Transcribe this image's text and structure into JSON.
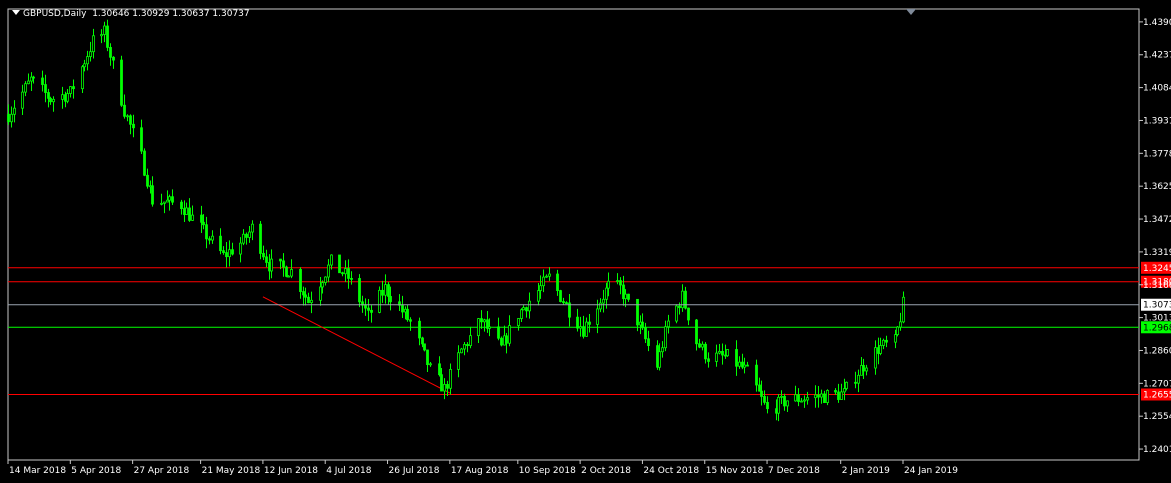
{
  "header": {
    "symbol_timeframe": "GBPUSD,Daily",
    "ohlc": "1.30646 1.30929 1.30637 1.30737"
  },
  "colors": {
    "background": "#000000",
    "frame": "#c8c8c8",
    "candle": "#00ff00",
    "red_line": "#ff0000",
    "green_line": "#00ff00",
    "price_line": "#9aa4b0",
    "trend_line": "#ff0000"
  },
  "chart_data": {
    "type": "candlestick",
    "timeframe": "Daily",
    "y_axis": {
      "position": "right",
      "ticks": [
        "1.4390",
        "1.4237",
        "1.4084",
        "1.3931",
        "1.3778",
        "1.3625",
        "1.3472",
        "1.3319",
        "1.3166",
        "1.3013",
        "1.2860",
        "1.2707",
        "1.2554",
        "1.2401"
      ],
      "range": [
        1.235,
        1.445
      ]
    },
    "x_axis": {
      "ticks": [
        "14 Mar 2018",
        "5 Apr 2018",
        "27 Apr 2018",
        "21 May 2018",
        "12 Jun 2018",
        "4 Jul 2018",
        "26 Jul 2018",
        "17 Aug 2018",
        "10 Sep 2018",
        "2 Oct 2018",
        "24 Oct 2018",
        "15 Nov 2018",
        "7 Dec 2018",
        "2 Jan 2019",
        "24 Jan 2019"
      ]
    },
    "current_price": "1.3073",
    "horizontal_lines": [
      {
        "price": 1.3245,
        "color": "#ff0000",
        "label": "1.3245"
      },
      {
        "price": 1.318,
        "color": "#ff0000",
        "label": "1.3180"
      },
      {
        "price": 1.2968,
        "color": "#00ff00",
        "label": "1.2968"
      },
      {
        "price": 1.2655,
        "color": "#ff0000",
        "label": "1.2655"
      }
    ],
    "trend_line": {
      "from": {
        "date": "12 Jun 2018",
        "price": 1.311
      },
      "to": {
        "date": "17 Aug 2018",
        "price": 1.2662
      }
    },
    "anchors": [
      {
        "t": "14 Mar 2018",
        "p": 1.396
      },
      {
        "t": "22 Mar 2018",
        "p": 1.412
      },
      {
        "t": "29 Mar 2018",
        "p": 1.403
      },
      {
        "t": "5 Apr 2018",
        "p": 1.406
      },
      {
        "t": "13 Apr 2018",
        "p": 1.43
      },
      {
        "t": "17 Apr 2018",
        "p": 1.434
      },
      {
        "t": "24 Apr 2018",
        "p": 1.398
      },
      {
        "t": "30 Apr 2018",
        "p": 1.376
      },
      {
        "t": "4 May 2018",
        "p": 1.356
      },
      {
        "t": "14 May 2018",
        "p": 1.354
      },
      {
        "t": "21 May 2018",
        "p": 1.343
      },
      {
        "t": "29 May 2018",
        "p": 1.33
      },
      {
        "t": "5 Jun 2018",
        "p": 1.337
      },
      {
        "t": "8 Jun 2018",
        "p": 1.343
      },
      {
        "t": "14 Jun 2018",
        "p": 1.326
      },
      {
        "t": "22 Jun 2018",
        "p": 1.323
      },
      {
        "t": "28 Jun 2018",
        "p": 1.309
      },
      {
        "t": "6 Jul 2018",
        "p": 1.327
      },
      {
        "t": "12 Jul 2018",
        "p": 1.32
      },
      {
        "t": "19 Jul 2018",
        "p": 1.302
      },
      {
        "t": "25 Jul 2018",
        "p": 1.315
      },
      {
        "t": "3 Aug 2018",
        "p": 1.299
      },
      {
        "t": "10 Aug 2018",
        "p": 1.277
      },
      {
        "t": "15 Aug 2018",
        "p": 1.268
      },
      {
        "t": "21 Aug 2018",
        "p": 1.286
      },
      {
        "t": "28 Aug 2018",
        "p": 1.3
      },
      {
        "t": "4 Sep 2018",
        "p": 1.287
      },
      {
        "t": "10 Sep 2018",
        "p": 1.303
      },
      {
        "t": "21 Sep 2018",
        "p": 1.32
      },
      {
        "t": "28 Sep 2018",
        "p": 1.305
      },
      {
        "t": "3 Oct 2018",
        "p": 1.296
      },
      {
        "t": "12 Oct 2018",
        "p": 1.316
      },
      {
        "t": "16 Oct 2018",
        "p": 1.315
      },
      {
        "t": "22 Oct 2018",
        "p": 1.3
      },
      {
        "t": "29 Oct 2018",
        "p": 1.279
      },
      {
        "t": "2 Nov 2018",
        "p": 1.299
      },
      {
        "t": "7 Nov 2018",
        "p": 1.311
      },
      {
        "t": "12 Nov 2018",
        "p": 1.29
      },
      {
        "t": "16 Nov 2018",
        "p": 1.283
      },
      {
        "t": "23 Nov 2018",
        "p": 1.283
      },
      {
        "t": "30 Nov 2018",
        "p": 1.276
      },
      {
        "t": "7 Dec 2018",
        "p": 1.258
      },
      {
        "t": "14 Dec 2018",
        "p": 1.263
      },
      {
        "t": "21 Dec 2018",
        "p": 1.264
      },
      {
        "t": "28 Dec 2018",
        "p": 1.265
      },
      {
        "t": "3 Jan 2019",
        "p": 1.266
      },
      {
        "t": "8 Jan 2019",
        "p": 1.276
      },
      {
        "t": "15 Jan 2019",
        "p": 1.287
      },
      {
        "t": "21 Jan 2019",
        "p": 1.29
      },
      {
        "t": "24 Jan 2019",
        "p": 1.3073
      }
    ]
  }
}
